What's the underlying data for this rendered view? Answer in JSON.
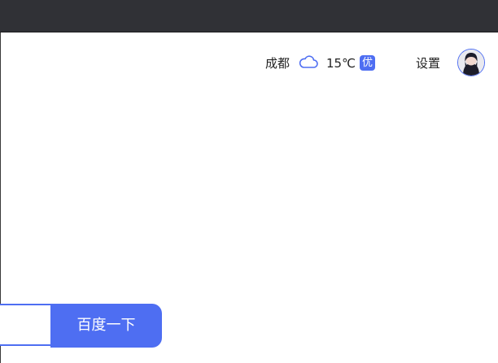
{
  "header": {
    "city": "成都",
    "weather_icon": "cloud-icon",
    "temperature": "15℃",
    "aqi_label": "优",
    "settings_label": "设置",
    "avatar_icon": "user-avatar"
  },
  "search": {
    "button_label": "百度一下",
    "input_value": ""
  },
  "colors": {
    "accent": "#4e6ef2",
    "top_bar": "#303136"
  }
}
